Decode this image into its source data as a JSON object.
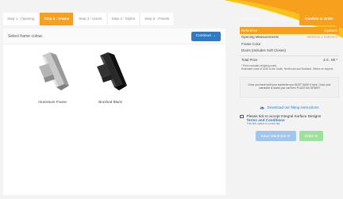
{
  "steps": [
    {
      "label": "Step 1 : Opening",
      "active": false
    },
    {
      "label": "Step 2 : Frame",
      "active": true
    },
    {
      "label": "Step 3 : Doors",
      "active": false
    },
    {
      "label": "Step 4 : Styles",
      "active": false
    },
    {
      "label": "Step 5 : Panels",
      "active": false
    }
  ],
  "right_tabs": {
    "tab1": "Select Styles",
    "tab2": "Select Panels",
    "confirm": "Confirm & Order"
  },
  "main": {
    "title": "Select frame colour.",
    "continue_label": "Continue →",
    "frames": [
      {
        "label": "Aluminium Frame"
      },
      {
        "label": "Brushed Black"
      }
    ]
  },
  "summary": {
    "reference_label": "Reference",
    "reference_value": "mydoors",
    "opening_label": "Opening Measurements",
    "opening_value": "3000mm x 2400mm",
    "frame_color_label": "Frame Color",
    "doors_label": "Doors (Includes Soft Closes)",
    "total_label": "Total Price",
    "total_value": "£ 0 . 00 *",
    "note_line1": "* Price excludes shipping costs.",
    "note_line2": "Estimated costs of £150 to the South, North east and Scotland. Others on request",
    "save_line1": "Once you have built your wardrobe you MUST SAVE it here. Once your",
    "save_line2": "wardrobe is saved you can then PLACE AN ORDER",
    "download_label": "Download our fitting instructions",
    "terms_line1": "Please tick to accept Integral Surface Designs",
    "terms_line2": "Terms and Conditions",
    "terms_line3": "This link opens in a new tab",
    "save_button": "Save Wardrobe ✉",
    "order_button": "Order ✉"
  },
  "colors": {
    "accent": "#f7a01d",
    "primary": "#2f7ac2"
  }
}
